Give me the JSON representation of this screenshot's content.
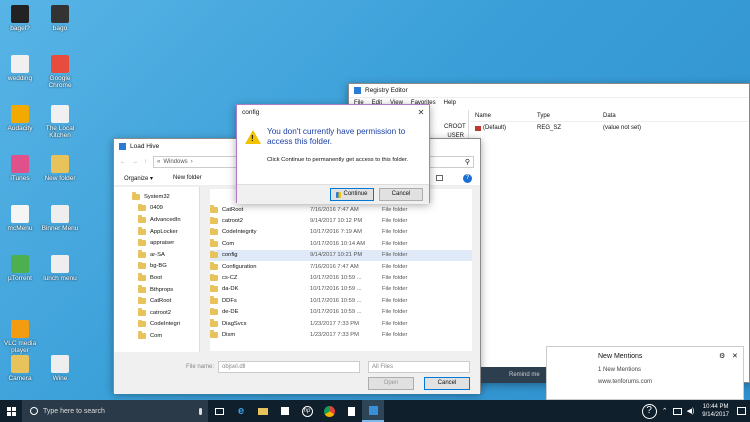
{
  "desktop_icons": [
    {
      "label": "bagel?",
      "color": "#222",
      "x": 0
    },
    {
      "label": "bago",
      "color": "#333",
      "x": 1
    },
    {
      "label": "wedding",
      "color": "#f0f0f0",
      "x": 0
    },
    {
      "label": "Google Chrome",
      "color": "#e84c3d",
      "x": 1
    },
    {
      "label": "Audacity",
      "color": "#f2a900",
      "x": 0
    },
    {
      "label": "The Local Kitchen",
      "color": "#f0f0f0",
      "x": 1
    },
    {
      "label": "iTunes",
      "color": "#e0508a",
      "x": 0
    },
    {
      "label": "New folder",
      "color": "#e8c25a",
      "x": 1
    },
    {
      "label": "mcMenu",
      "color": "#f5f5f5",
      "x": 0
    },
    {
      "label": "Binner Menu",
      "color": "#eee",
      "x": 1
    },
    {
      "label": "µTorrent",
      "color": "#4caf50",
      "x": 0
    },
    {
      "label": "lunch menu",
      "color": "#eee",
      "x": 1
    },
    {
      "label": "VLC media player",
      "color": "#f39c12",
      "x": 0
    },
    {
      "label": "Camera",
      "color": "#e8c25a",
      "x": 0
    },
    {
      "label": "Wine",
      "color": "#eee",
      "x": 1
    }
  ],
  "registry": {
    "title": "Registry Editor",
    "menu": [
      "File",
      "Edit",
      "View",
      "Favorites",
      "Help"
    ],
    "tree_partial": [
      "CROOT",
      "_USER"
    ],
    "columns": [
      "Name",
      "Type",
      "Data"
    ],
    "row": {
      "name": "(Default)",
      "type": "REG_SZ",
      "data": "(value not set)"
    }
  },
  "load_hive": {
    "title": "Load Hive",
    "breadcrumb": [
      "«",
      "Windows",
      "›"
    ],
    "toolbar": {
      "organize": "Organize ▾",
      "new_folder": "New folder"
    },
    "tree": [
      "System32",
      "0409",
      "AdvancedIn",
      "AppLocker",
      "appraiser",
      "ar-SA",
      "bg-BG",
      "Boot",
      "Bthprops",
      "CatRoot",
      "catroot2",
      "CodeIntegri",
      "Com"
    ],
    "files": [
      {
        "name": "CatRoot",
        "date": "7/16/2016 7:47 AM",
        "type": "File folder"
      },
      {
        "name": "catroot2",
        "date": "9/14/2017 10:12 PM",
        "type": "File folder"
      },
      {
        "name": "CodeIntegrity",
        "date": "10/17/2016 7:19 AM",
        "type": "File folder"
      },
      {
        "name": "Com",
        "date": "10/17/2016 10:14 AM",
        "type": "File folder"
      },
      {
        "name": "config",
        "date": "9/14/2017 10:21 PM",
        "type": "File folder"
      },
      {
        "name": "Configuration",
        "date": "7/16/2016 7:47 AM",
        "type": "File folder"
      },
      {
        "name": "cs-CZ",
        "date": "10/17/2016 10:59 ...",
        "type": "File folder"
      },
      {
        "name": "da-DK",
        "date": "10/17/2016 10:59 ...",
        "type": "File folder"
      },
      {
        "name": "DDFs",
        "date": "10/17/2016 10:59 ...",
        "type": "File folder"
      },
      {
        "name": "de-DE",
        "date": "10/17/2016 10:59 ...",
        "type": "File folder"
      },
      {
        "name": "DiagSvcs",
        "date": "1/23/2017 7:33 PM",
        "type": "File folder"
      },
      {
        "name": "Dism",
        "date": "1/23/2017 7:33 PM",
        "type": "File folder"
      }
    ],
    "file_name_label": "File name:",
    "file_name_value": "objsel.dll",
    "filter": "All Files",
    "open": "Open",
    "cancel": "Cancel"
  },
  "dialog": {
    "title": "config",
    "heading": "You don't currently have permission to access this folder.",
    "body": "Click Continue to permanently get access to this folder.",
    "continue": "Continue",
    "cancel": "Cancel"
  },
  "notification": {
    "title": "New Mentions",
    "line1": "1 New Mentions",
    "line2": "www.tenforums.com",
    "remind": "Remind me"
  },
  "taskbar": {
    "search_placeholder": "Type here to search",
    "time": "10:44 PM",
    "date": "9/14/2017"
  }
}
